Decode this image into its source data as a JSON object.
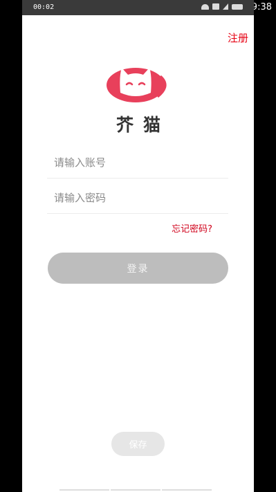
{
  "status_bar": {
    "time": "9:38",
    "icons": [
      "wifi-icon",
      "signal-off-icon",
      "battery-icon"
    ]
  },
  "inner_status_bar": {
    "time": "00:02",
    "icons": [
      "wifi-icon",
      "hd-icon",
      "signal-icon",
      "battery-icon"
    ]
  },
  "header": {
    "register_label": "注册"
  },
  "brand": {
    "name": "芥猫",
    "logo_icon": "cat-face-icon",
    "logo_color": "#e8405b"
  },
  "form": {
    "account_placeholder": "请输入账号",
    "password_placeholder": "请输入密码",
    "forgot_password_label": "忘记密码?",
    "login_label": "登录"
  },
  "footer": {
    "save_label": "保存"
  },
  "colors": {
    "accent_red": "#e60012",
    "button_disabled": "#bdbdbd"
  }
}
